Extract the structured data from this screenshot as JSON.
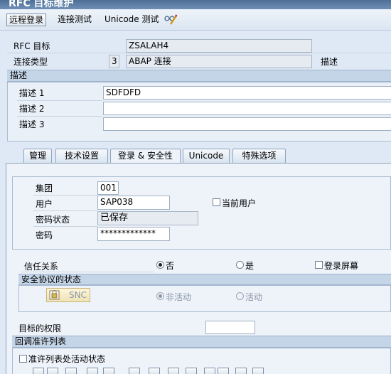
{
  "window": {
    "title": "RFC 目标维护"
  },
  "toolbar": {
    "remote_login": "远程登录",
    "connection_test": "连接测试",
    "unicode_test": "Unicode 测试",
    "edit_icon": "pencil-glasses-icon"
  },
  "header": {
    "rfc_target_label": "RFC 目标",
    "rfc_target_value": "ZSALAH4",
    "conn_type_label": "连接类型",
    "conn_type_code": "3",
    "conn_type_value": "ABAP 连接",
    "desc_right": "描述"
  },
  "description": {
    "section_title": "描述",
    "desc1_label": "描述 1",
    "desc1_value": "SDFDFD",
    "desc2_label": "描述 2",
    "desc2_value": "",
    "desc3_label": "描述 3",
    "desc3_value": ""
  },
  "tabs": [
    {
      "label": "管理"
    },
    {
      "label": "技术设置"
    },
    {
      "label": "登录 & 安全性"
    },
    {
      "label": "Unicode"
    },
    {
      "label": "特殊选项"
    }
  ],
  "logon": {
    "client_label": "集团",
    "client_value": "001",
    "user_label": "用户",
    "user_value": "SAP038",
    "current_user_label": "当前用户",
    "pw_status_label": "密码状态",
    "pw_status_value": "已保存",
    "password_label": "密码",
    "password_value": "*************"
  },
  "trust": {
    "label": "信任关系",
    "no": "否",
    "yes": "是",
    "logon_screen": "登录屏幕",
    "selected": "否"
  },
  "security_protocol": {
    "section_title": "安全协议的状态",
    "snc_label": "SNC",
    "inactive": "非活动",
    "active": "活动",
    "selected": "非活动"
  },
  "target_authority": {
    "label": "目标的权限",
    "value": ""
  },
  "callback": {
    "section_title": "回调准许列表",
    "checkbox_label": "准许列表处活动状态"
  }
}
